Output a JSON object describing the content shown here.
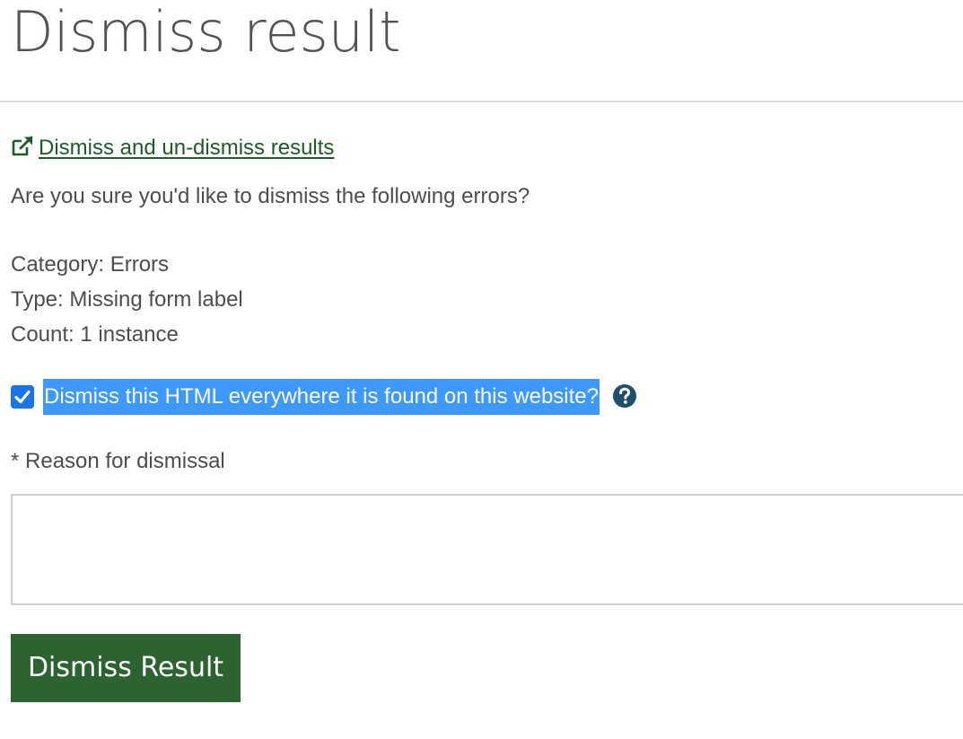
{
  "page": {
    "title": "Dismiss result"
  },
  "help_link": {
    "icon": "external-link-icon",
    "label": " Dismiss and un-dismiss results"
  },
  "confirm_text": "Are you sure you'd like to dismiss the following errors?",
  "details": {
    "category": "Category: Errors",
    "type": "Type: Missing form label",
    "count": "Count: 1 instance"
  },
  "dismiss_everywhere": {
    "checked": true,
    "label": "Dismiss this HTML everywhere it is found on this website?",
    "help_icon": "question-circle-icon"
  },
  "reason": {
    "label": "* Reason for dismissal",
    "value": ""
  },
  "submit": {
    "label": "Dismiss Result"
  },
  "colors": {
    "link": "#1e5b27",
    "button_bg": "#2b6430",
    "selection_bg": "#3d98ff",
    "checkbox": "#1a73e8",
    "help_icon": "#1f4f6b"
  }
}
